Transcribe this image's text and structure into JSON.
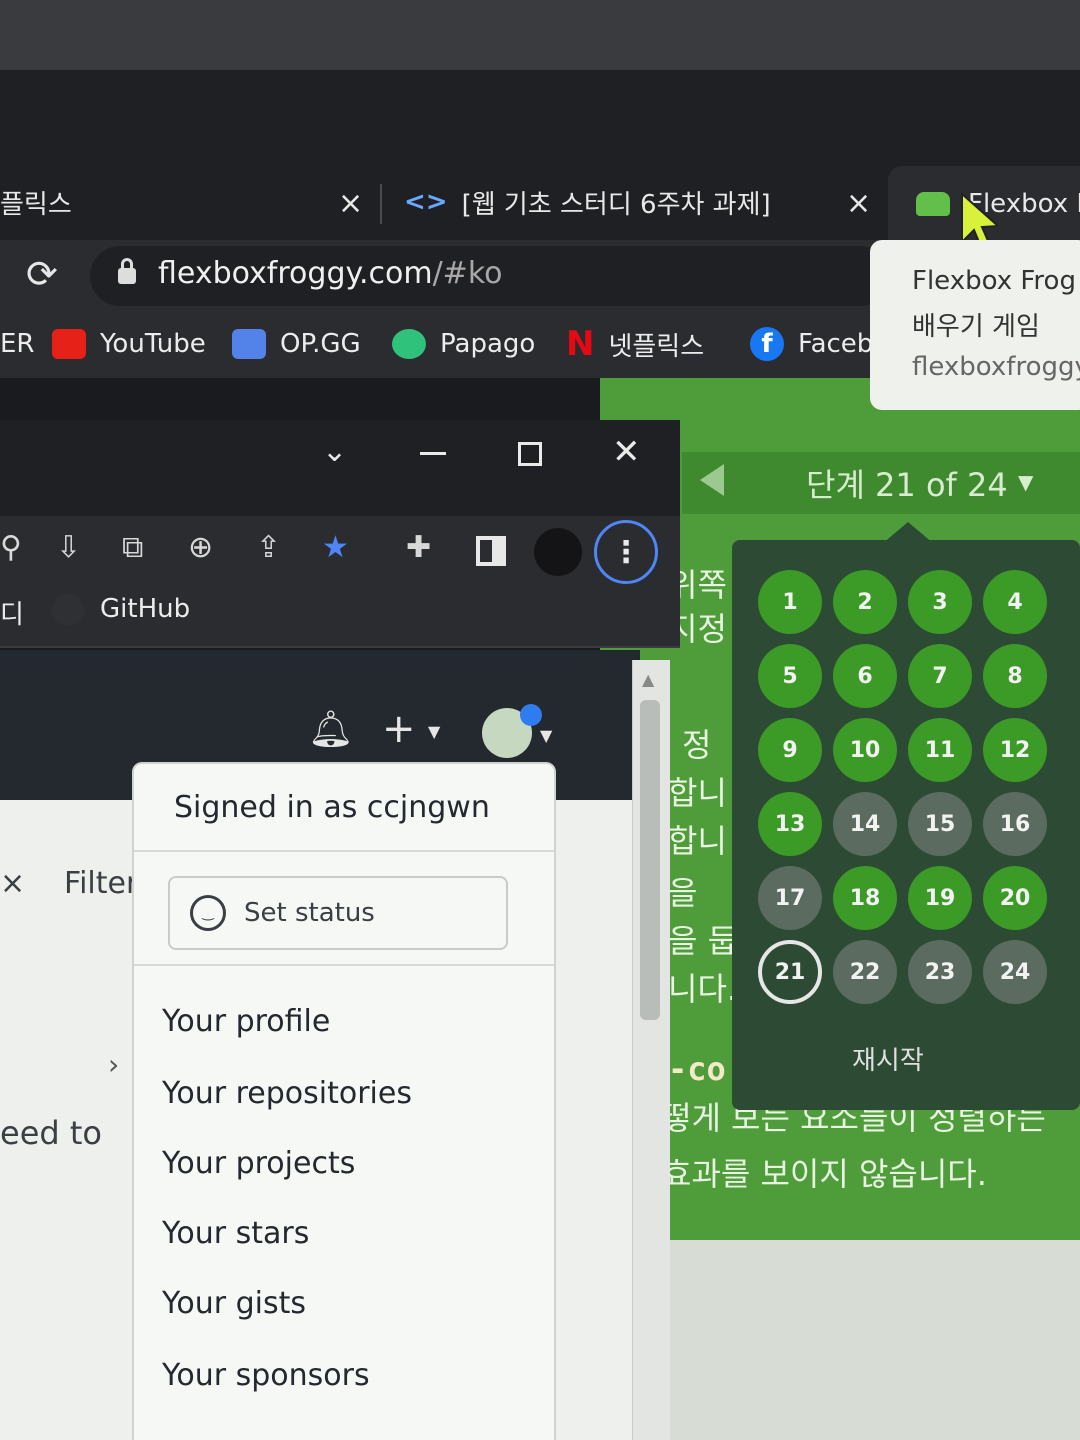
{
  "browser": {
    "tabs": [
      {
        "title": "플릭스",
        "close": "×"
      },
      {
        "title": "[웹 기초 스터디 6주차 과제]",
        "close": "×"
      },
      {
        "title": "Flexbox F"
      }
    ],
    "url": {
      "host": "flexboxfroggy.com",
      "path": "/#ko"
    },
    "bookmarks": [
      {
        "label": "ER"
      },
      {
        "label": "YouTube"
      },
      {
        "label": "OP.GG"
      },
      {
        "label": "Papago"
      },
      {
        "label": "넷플릭스"
      },
      {
        "label": "Faceb"
      }
    ],
    "tooltip": {
      "title": "Flexbox Frog",
      "subtitle": "배우기 게임",
      "domain": "flexboxfroggy"
    }
  },
  "froggy": {
    "level_label": "단계 21 of 24",
    "levels": [
      {
        "n": "1",
        "state": "done"
      },
      {
        "n": "2",
        "state": "done"
      },
      {
        "n": "3",
        "state": "done"
      },
      {
        "n": "4",
        "state": "done"
      },
      {
        "n": "5",
        "state": "done"
      },
      {
        "n": "6",
        "state": "done"
      },
      {
        "n": "7",
        "state": "done"
      },
      {
        "n": "8",
        "state": "done"
      },
      {
        "n": "9",
        "state": "done"
      },
      {
        "n": "10",
        "state": "done"
      },
      {
        "n": "11",
        "state": "done"
      },
      {
        "n": "12",
        "state": "done"
      },
      {
        "n": "13",
        "state": "done"
      },
      {
        "n": "14",
        "state": "todo"
      },
      {
        "n": "15",
        "state": "todo"
      },
      {
        "n": "16",
        "state": "todo"
      },
      {
        "n": "17",
        "state": "todo"
      },
      {
        "n": "18",
        "state": "done"
      },
      {
        "n": "19",
        "state": "done"
      },
      {
        "n": "20",
        "state": "done"
      },
      {
        "n": "21",
        "state": "current"
      },
      {
        "n": "22",
        "state": "todo"
      },
      {
        "n": "23",
        "state": "todo"
      },
      {
        "n": "24",
        "state": "todo"
      }
    ],
    "restart": "재시작",
    "side_text": [
      "위쪽",
      "지정",
      "정",
      "합니",
      "합니",
      "을 ",
      "을 둡",
      "니다.",
      "-co"
    ],
    "instructions": [
      "떻게 보는 요소들이 정렬하는",
      "효과를 보이지 않습니다."
    ]
  },
  "window2": {
    "bookmark_prefix": "디",
    "bookmark_github": "GitHub"
  },
  "github": {
    "filter_label": "Filter",
    "left_text": "eed to",
    "menu": {
      "signed_in": "Signed in as ccjngwn",
      "set_status": "Set status",
      "items": [
        "Your profile",
        "Your repositories",
        "Your projects",
        "Your stars",
        "Your gists",
        "Your sponsors"
      ]
    }
  },
  "colors": {
    "froggy_green": "#4f9d3a",
    "level_done": "#3c9a27",
    "level_todo": "#5b6b60",
    "focus_ring": "#4f86f7",
    "star": "#4f86f7"
  }
}
